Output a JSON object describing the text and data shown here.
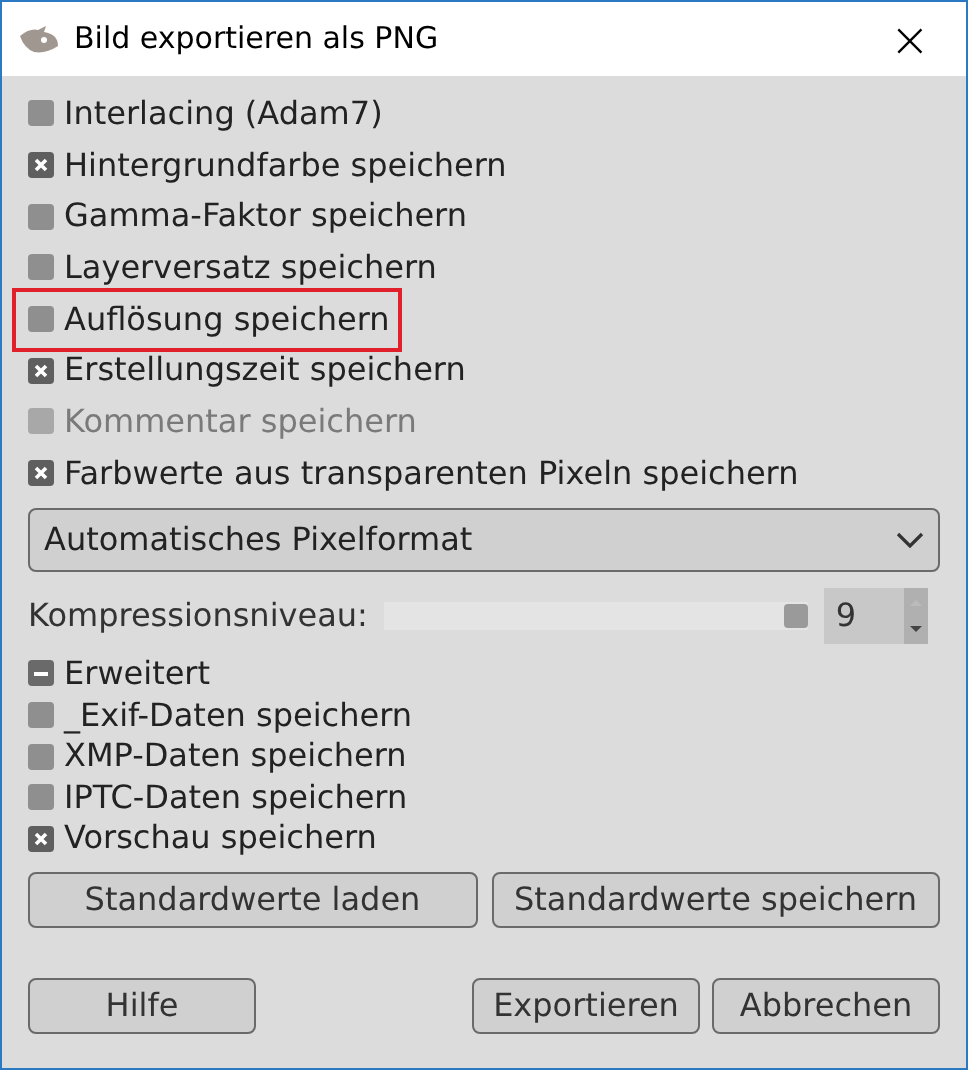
{
  "window": {
    "title": "Bild exportieren als PNG",
    "close": "×"
  },
  "options": [
    {
      "label": "Interlacing (Adam7)",
      "checked": false,
      "disabled": false,
      "highlighted": false
    },
    {
      "label": "Hintergrundfarbe speichern",
      "checked": true,
      "disabled": false,
      "highlighted": false
    },
    {
      "label": "Gamma-Faktor speichern",
      "checked": false,
      "disabled": false,
      "highlighted": false
    },
    {
      "label": "Layerversatz speichern",
      "checked": false,
      "disabled": false,
      "highlighted": false
    },
    {
      "label": "Auflösung speichern",
      "checked": false,
      "disabled": false,
      "highlighted": true
    },
    {
      "label": "Erstellungszeit speichern",
      "checked": true,
      "disabled": false,
      "highlighted": false
    },
    {
      "label": "Kommentar speichern",
      "checked": false,
      "disabled": true,
      "highlighted": false
    },
    {
      "label": "Farbwerte aus transparenten Pixeln speichern",
      "checked": true,
      "disabled": false,
      "highlighted": false
    }
  ],
  "pixel_format": {
    "value": "Automatisches Pixelformat"
  },
  "compression": {
    "label": "Kompressionsniveau:",
    "level": 1,
    "value": "9"
  },
  "advanced": {
    "label": "Erweitert",
    "expanded": true,
    "options": [
      {
        "label": "_Exif-Daten speichern",
        "checked": false
      },
      {
        "label": "XMP-Daten speichern",
        "checked": false
      },
      {
        "label": "IPTC-Daten speichern",
        "checked": false
      },
      {
        "label": "Vorschau speichern",
        "checked": true
      }
    ]
  },
  "default_buttons": [
    "Standardwerte laden",
    "Standardwerte speichern"
  ],
  "help_button": "Hilfe",
  "action_buttons": [
    "Exportieren",
    "Abbrechen"
  ]
}
